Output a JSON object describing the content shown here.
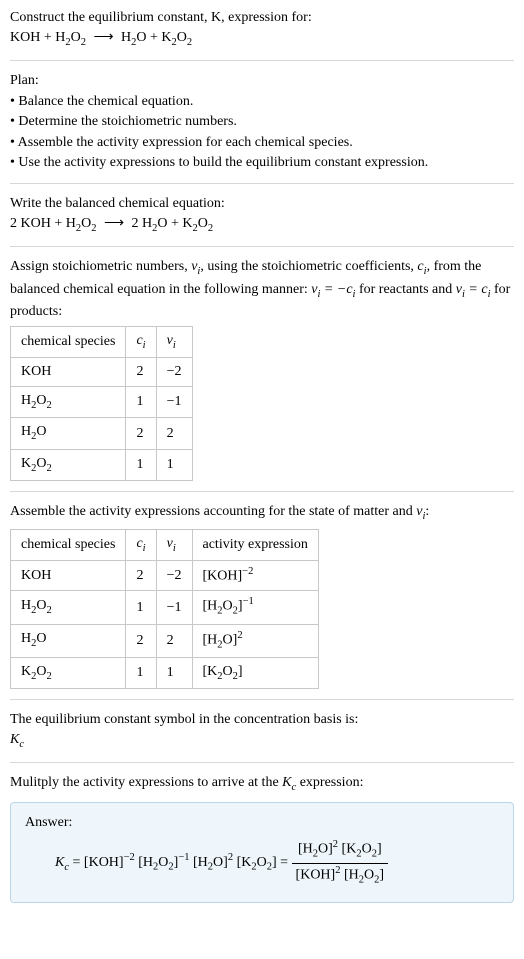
{
  "intro": {
    "line1": "Construct the equilibrium constant, K, expression for:",
    "equation_lhs_1": "KOH + H",
    "equation_lhs_2": "O",
    "equation_rhs_1": "H",
    "equation_rhs_2": "O + K",
    "equation_rhs_3": "O"
  },
  "plan": {
    "heading": "Plan:",
    "b1": "• Balance the chemical equation.",
    "b2": "• Determine the stoichiometric numbers.",
    "b3": "• Assemble the activity expression for each chemical species.",
    "b4": "• Use the activity expressions to build the equilibrium constant expression."
  },
  "balanced": {
    "heading": "Write the balanced chemical equation:",
    "lhs_1": "2 KOH + H",
    "lhs_2": "O",
    "rhs_1": "2 H",
    "rhs_2": "O + K",
    "rhs_3": "O"
  },
  "assign": {
    "text_a": "Assign stoichiometric numbers, ",
    "text_b": ", using the stoichiometric coefficients, ",
    "text_c": ", from the balanced chemical equation in the following manner: ",
    "text_d": " for reactants and ",
    "text_e": " for products:"
  },
  "table1": {
    "h1": "chemical species",
    "h2": "c",
    "h3": "ν",
    "r1": {
      "sp": "KOH",
      "c": "2",
      "v": "−2"
    },
    "r2": {
      "sp_a": "H",
      "sp_b": "O",
      "c": "1",
      "v": "−1"
    },
    "r3": {
      "sp_a": "H",
      "sp_b": "O",
      "c": "2",
      "v": "2"
    },
    "r4": {
      "sp_a": "K",
      "sp_b": "O",
      "c": "1",
      "v": "1"
    }
  },
  "assemble": {
    "text_a": "Assemble the activity expressions accounting for the state of matter and ",
    "text_b": ":"
  },
  "table2": {
    "h1": "chemical species",
    "h2": "c",
    "h3": "ν",
    "h4": "activity expression",
    "r1": {
      "sp": "KOH",
      "c": "2",
      "v": "−2",
      "act_a": "[KOH]",
      "act_exp": "−2"
    },
    "r2": {
      "sp_a": "H",
      "sp_b": "O",
      "c": "1",
      "v": "−1",
      "act_base_a": "[H",
      "act_base_b": "O",
      "act_base_c": "]",
      "act_exp": "−1"
    },
    "r3": {
      "sp_a": "H",
      "sp_b": "O",
      "c": "2",
      "v": "2",
      "act_base_a": "[H",
      "act_base_b": "O]",
      "act_exp": "2"
    },
    "r4": {
      "sp_a": "K",
      "sp_b": "O",
      "c": "1",
      "v": "1",
      "act_base_a": "[K",
      "act_base_b": "O",
      "act_base_c": "]"
    }
  },
  "symbol": {
    "line1": "The equilibrium constant symbol in the concentration basis is:",
    "Kc_K": "K",
    "Kc_c": "c"
  },
  "multiply": {
    "text_a": "Mulitply the activity expressions to arrive at the ",
    "text_b": " expression:"
  },
  "answer": {
    "label": "Answer:",
    "Kc_K": "K",
    "Kc_c": "c",
    "eq": " = ",
    "term1_a": "[KOH]",
    "term1_exp": "−2",
    "term2_a": "[H",
    "term2_b": "O",
    "term2_c": "]",
    "term2_exp": "−1",
    "term3_a": "[H",
    "term3_b": "O]",
    "term3_exp": "2",
    "term4_a": "[K",
    "term4_b": "O",
    "term4_c": "]",
    "eq2": " = ",
    "num_a": "[H",
    "num_b": "O]",
    "num_exp": "2",
    "num2_a": "[K",
    "num2_b": "O",
    "num2_c": "]",
    "den_a": "[KOH]",
    "den_exp": "2",
    "den2_a": "[H",
    "den2_b": "O",
    "den2_c": "]"
  }
}
